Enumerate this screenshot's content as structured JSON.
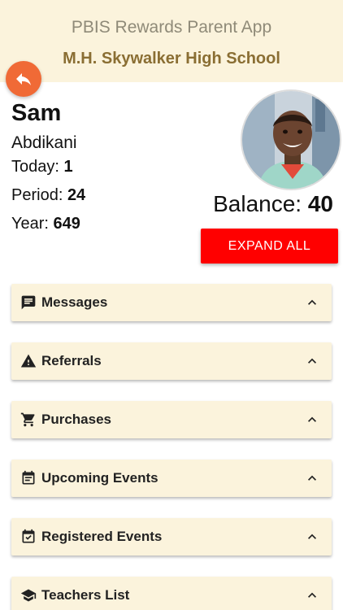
{
  "header": {
    "app_title": "PBIS Rewards Parent App",
    "school_name": "M.H. Skywalker High School"
  },
  "student": {
    "first_name": "Sam",
    "last_name": "Abdikani",
    "today_label": "Today:",
    "today_value": "1",
    "period_label": "Period:",
    "period_value": "24",
    "year_label": "Year:",
    "year_value": "649",
    "balance_label": "Balance:",
    "balance_value": "40"
  },
  "actions": {
    "expand_all": "EXPAND ALL"
  },
  "panels": [
    {
      "label": "Messages",
      "icon": "message-icon"
    },
    {
      "label": "Referrals",
      "icon": "warning-icon"
    },
    {
      "label": "Purchases",
      "icon": "cart-icon"
    },
    {
      "label": "Upcoming Events",
      "icon": "calendar-icon"
    },
    {
      "label": "Registered Events",
      "icon": "calendar-check-icon"
    },
    {
      "label": "Teachers List",
      "icon": "school-icon"
    }
  ],
  "colors": {
    "header_bg": "#fbf3dc",
    "school_name": "#8a6e33",
    "back_button": "#f06a36",
    "expand_button": "#ff0000",
    "panel_bg": "#fbf3dc"
  }
}
